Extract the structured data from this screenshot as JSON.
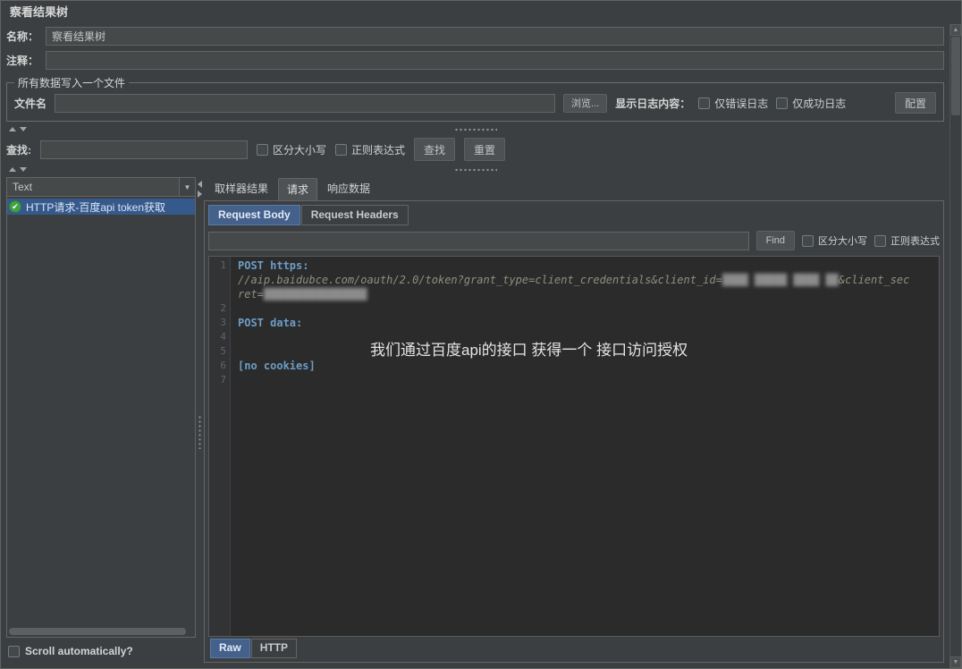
{
  "colors": {
    "selection_blue": "#44618c",
    "tree_selection_blue": "#36598c",
    "success_green": "#43a047",
    "code_background": "#2b2b2b",
    "window_background": "#3c3f41"
  },
  "header": {
    "title": "察看结果树"
  },
  "fields": {
    "name_label": "名称：",
    "name_value": "察看结果树",
    "comment_label": "注释：",
    "comment_value": ""
  },
  "file_group": {
    "legend": "所有数据写入一个文件",
    "filename_label": "文件名",
    "filename_value": "",
    "browse_button": "浏览...",
    "log_content_label": "显示日志内容：",
    "errors_only": "仅错误日志",
    "success_only": "仅成功日志",
    "config_button": "配置"
  },
  "find_bar": {
    "label": "查找:",
    "value": "",
    "case_sensitive": "区分大小写",
    "regex": "正则表达式",
    "find_button": "查找",
    "reset_button": "重置"
  },
  "left_panel": {
    "view_mode": "Text",
    "tree_item": "HTTP请求-百度api token获取",
    "scroll_label": "Scroll automatically?"
  },
  "right_panel": {
    "tabs": [
      "取样器结果",
      "请求",
      "响应数据"
    ],
    "inner_tabs": [
      "Request Body",
      "Request Headers"
    ],
    "search": {
      "value": "",
      "find_button": "Find",
      "case_sensitive": "区分大小写",
      "regex": "正则表达式"
    },
    "bottom_tabs": [
      "Raw",
      "HTTP"
    ]
  },
  "code": {
    "annotation": "我们通过百度api的接口 获得一个 接口访问授权",
    "rows": [
      {
        "num": "1",
        "segments": [
          {
            "text": "POST https:",
            "cls": "kw"
          }
        ]
      },
      {
        "num": "",
        "segments": [
          {
            "text": "//aip.baidubce.com/oauth/2.0/token?grant_type=client_credentials&client_id=",
            "cls": "url"
          },
          {
            "text": "████ █████ ████ ██",
            "cls": "redacted"
          },
          {
            "text": "&client_sec",
            "cls": "url"
          }
        ]
      },
      {
        "num": "",
        "segments": [
          {
            "text": "ret=",
            "cls": "url"
          },
          {
            "text": "████████████████",
            "cls": "redacted"
          }
        ]
      },
      {
        "num": "2",
        "segments": []
      },
      {
        "num": "3",
        "segments": [
          {
            "text": "POST data:",
            "cls": "kw"
          }
        ]
      },
      {
        "num": "4",
        "segments": []
      },
      {
        "num": "5",
        "segments": []
      },
      {
        "num": "6",
        "segments": [
          {
            "text": "[no cookies]",
            "cls": "cookie"
          }
        ]
      },
      {
        "num": "7",
        "segments": []
      }
    ]
  }
}
